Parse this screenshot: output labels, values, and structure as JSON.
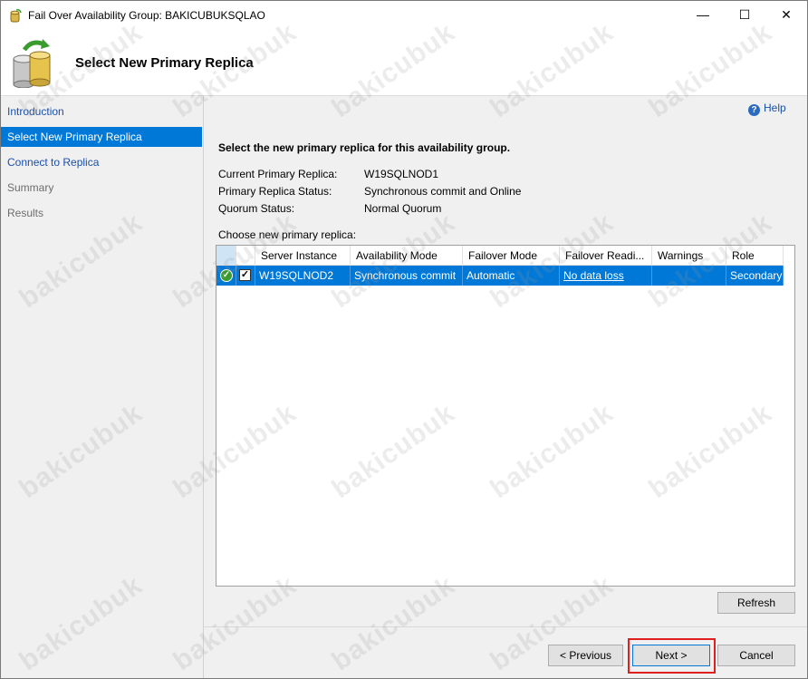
{
  "window": {
    "title": "Fail Over Availability Group: BAKICUBUKSQLAO",
    "controls": {
      "minimize": "—",
      "maximize": "☐",
      "close": "✕"
    }
  },
  "header": {
    "title": "Select New Primary Replica",
    "icon": "database-failover-icon"
  },
  "sidebar": {
    "items": [
      {
        "label": "Introduction",
        "state": "link"
      },
      {
        "label": "Select New Primary Replica",
        "state": "selected"
      },
      {
        "label": "Connect to Replica",
        "state": "link"
      },
      {
        "label": "Summary",
        "state": "disabled"
      },
      {
        "label": "Results",
        "state": "disabled"
      }
    ]
  },
  "help": {
    "label": "Help",
    "icon": "help-icon"
  },
  "main": {
    "instruction": "Select the new primary replica for this availability group.",
    "info": [
      {
        "label": "Current Primary Replica:",
        "value": "W19SQLNOD1"
      },
      {
        "label": "Primary Replica Status:",
        "value": "Synchronous commit and Online"
      },
      {
        "label": "Quorum Status:",
        "value": "Normal Quorum"
      }
    ],
    "choose_label": "Choose new primary replica:"
  },
  "grid": {
    "columns": [
      "Server Instance",
      "Availability Mode",
      "Failover Mode",
      "Failover Readi...",
      "Warnings",
      "Role"
    ],
    "rows": [
      {
        "status_icon": "green-check-icon",
        "checked": "✓",
        "server_instance": "W19SQLNOD2",
        "availability_mode": "Synchronous commit",
        "failover_mode": "Automatic",
        "failover_readiness": "No data loss",
        "warnings": "",
        "role": "Secondary"
      }
    ]
  },
  "buttons": {
    "refresh": "Refresh",
    "previous": "< Previous",
    "next": "Next >",
    "cancel": "Cancel"
  },
  "watermark": "bakicubuk",
  "colors": {
    "selection": "#0078d7",
    "link": "#1c4fa6",
    "highlight": "#e02020"
  }
}
